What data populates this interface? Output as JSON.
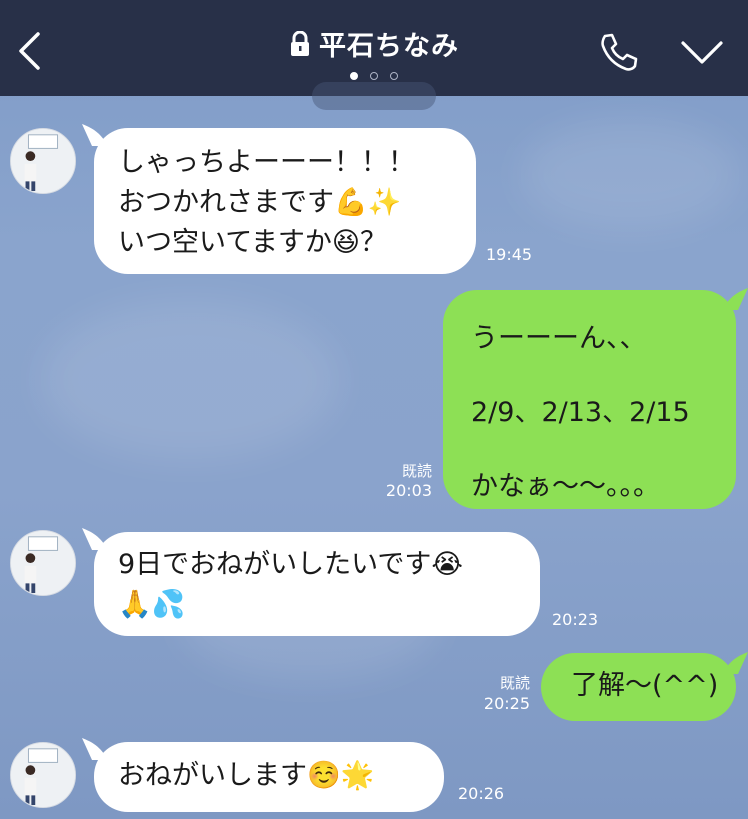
{
  "header": {
    "title": "平石ちなみ",
    "back_icon": "chevron-left-icon",
    "lock_icon": "lock-icon",
    "call_icon": "phone-icon",
    "menu_icon": "chevron-down-icon",
    "page_indicator": {
      "count": 3,
      "active": 1
    }
  },
  "colors": {
    "header_bg": "#283048",
    "chat_bg": "#8aa4cd",
    "incoming_bubble": "#ffffff",
    "outgoing_bubble": "#8de055"
  },
  "messages": [
    {
      "direction": "in",
      "lines": [
        "しゃっちよーーー！！！",
        "おつかれさまです💪✨",
        "いつ空いてますか😆？"
      ],
      "time": "19:45"
    },
    {
      "direction": "out",
      "lines": [
        "うーーーん、、",
        "2/9、2/13、2/15",
        "かなぁ〜〜。。。"
      ],
      "read": "既読",
      "time": "20:03"
    },
    {
      "direction": "in",
      "lines": [
        "9日でおねがいしたいです😭",
        "🙏💦"
      ],
      "time": "20:23"
    },
    {
      "direction": "out",
      "lines": [
        "了解〜(^^)"
      ],
      "read": "既読",
      "time": "20:25"
    },
    {
      "direction": "in",
      "lines": [
        "おねがいします☺️🌟"
      ],
      "time": "20:26"
    }
  ]
}
